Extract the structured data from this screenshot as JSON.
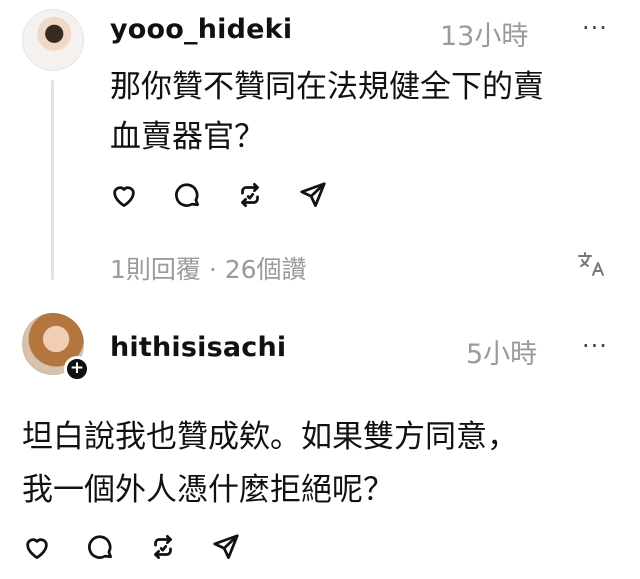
{
  "post1": {
    "username": "yooo_hideki",
    "time": "13小時",
    "more": "···",
    "text_line1": "那你贊不贊同在法規健全下的賣",
    "text_line2": "血賣器官？",
    "meta_replies": "1則回覆",
    "meta_sep": " · ",
    "meta_likes": "26個讚",
    "translate_icon": "translate-icon"
  },
  "post2": {
    "username": "hithisisachi",
    "time": "5小時",
    "more": "···",
    "text_line1": "坦白說我也贊成欸。如果雙方同意，",
    "text_line2": "我一個外人憑什麼拒絕呢？",
    "follow_badge": "+"
  },
  "icons": [
    "heart-icon",
    "comment-icon",
    "repost-icon",
    "share-icon"
  ],
  "colors": {
    "text": "#111111",
    "muted": "#9a9a9a",
    "line": "#e1e1e1"
  }
}
